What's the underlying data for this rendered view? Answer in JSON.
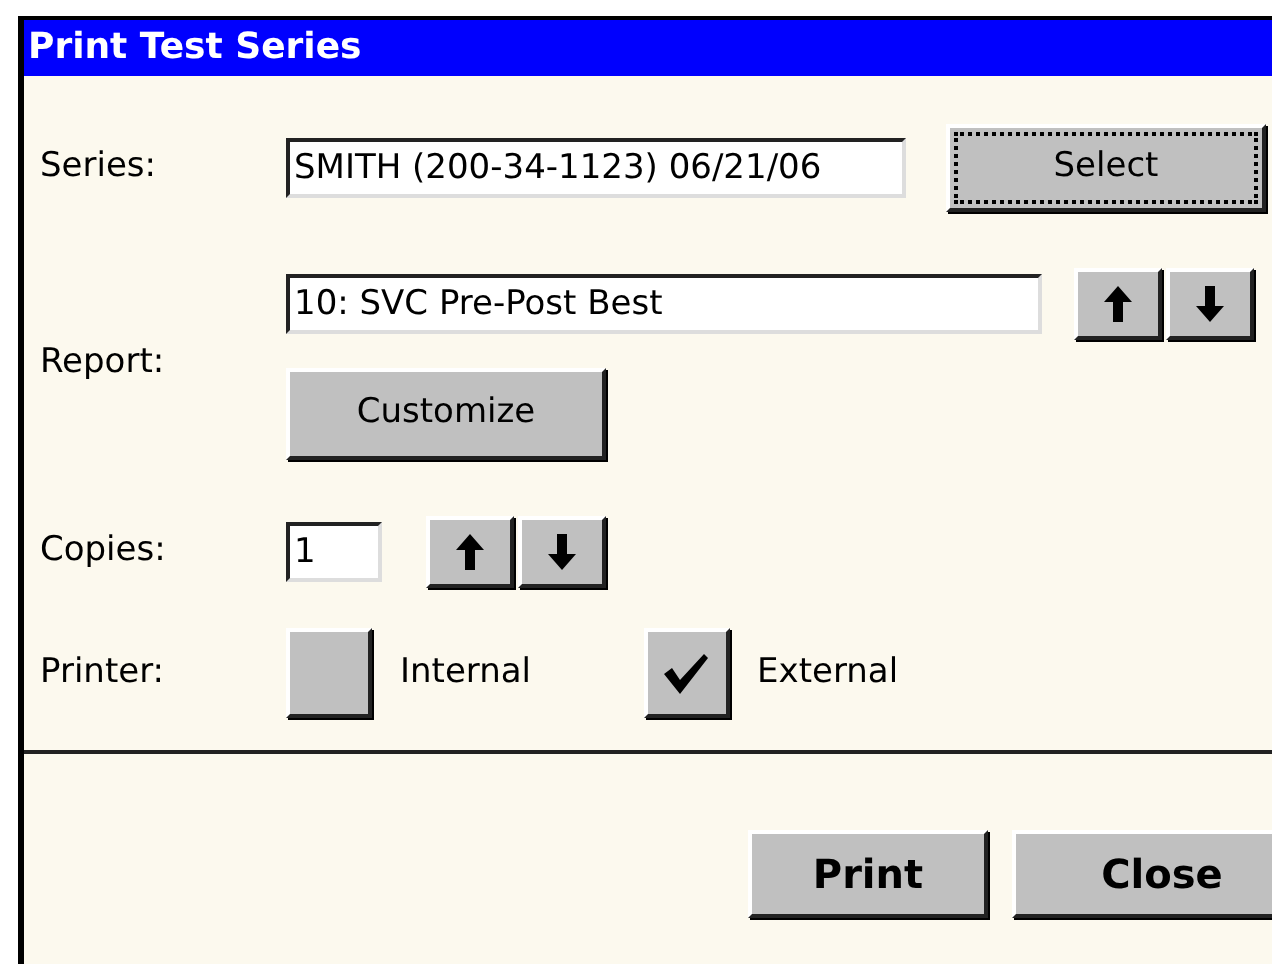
{
  "window": {
    "title": "Print Test Series"
  },
  "series": {
    "label": "Series:",
    "value": "SMITH (200-34-1123) 06/21/06",
    "button": {
      "label": "Select",
      "focused": true
    }
  },
  "report": {
    "label": "Report:",
    "value": "10: SVC Pre-Post Best",
    "button": {
      "label": "Customize",
      "focused": false
    }
  },
  "copies": {
    "label": "Copies:",
    "value": "1"
  },
  "printer": {
    "label": "Printer:",
    "options": [
      {
        "label": "Internal",
        "checked": false
      },
      {
        "label": "External",
        "checked": true
      }
    ]
  },
  "buttons": [
    {
      "label": "Print",
      "focused": false
    },
    {
      "label": "Close",
      "focused": false
    }
  ]
}
